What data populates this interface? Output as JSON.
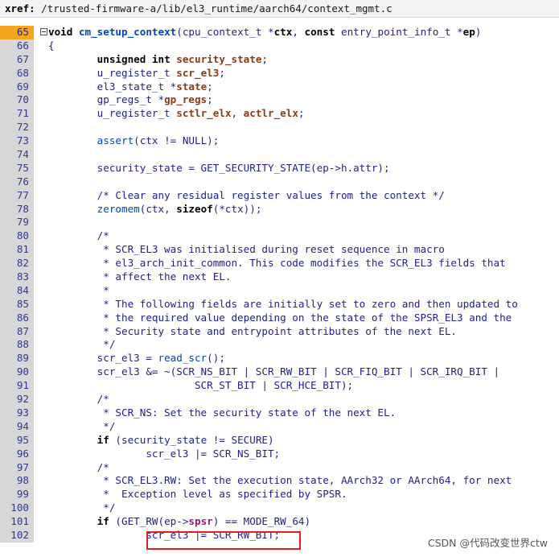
{
  "xref": {
    "label": "xref:",
    "path": "/trusted-firmware-a/lib/el3_runtime/aarch64/context_mgmt.c"
  },
  "code": {
    "lines": [
      {
        "no": "65",
        "text": "void cm_setup_context(cpu_context_t *ctx, const entry_point_info_t *ep)"
      },
      {
        "no": "66",
        "text": "{"
      },
      {
        "no": "67",
        "text": "unsigned int security_state;"
      },
      {
        "no": "68",
        "text": "u_register_t scr_el3;"
      },
      {
        "no": "69",
        "text": "el3_state_t *state;"
      },
      {
        "no": "70",
        "text": "gp_regs_t *gp_regs;"
      },
      {
        "no": "71",
        "text": "u_register_t sctlr_elx, actlr_elx;"
      },
      {
        "no": "72",
        "text": ""
      },
      {
        "no": "73",
        "text": "assert(ctx != NULL);"
      },
      {
        "no": "74",
        "text": ""
      },
      {
        "no": "75",
        "text": "security_state = GET_SECURITY_STATE(ep->h.attr);"
      },
      {
        "no": "76",
        "text": ""
      },
      {
        "no": "77",
        "text": "/* Clear any residual register values from the context */"
      },
      {
        "no": "78",
        "text": "zeromem(ctx, sizeof(*ctx));"
      },
      {
        "no": "79",
        "text": ""
      },
      {
        "no": "80",
        "text": "/*"
      },
      {
        "no": "81",
        "text": " * SCR_EL3 was initialised during reset sequence in macro"
      },
      {
        "no": "82",
        "text": " * el3_arch_init_common. This code modifies the SCR_EL3 fields that"
      },
      {
        "no": "83",
        "text": " * affect the next EL."
      },
      {
        "no": "84",
        "text": " *"
      },
      {
        "no": "85",
        "text": " * The following fields are initially set to zero and then updated to"
      },
      {
        "no": "86",
        "text": " * the required value depending on the state of the SPSR_EL3 and the"
      },
      {
        "no": "87",
        "text": " * Security state and entrypoint attributes of the next EL."
      },
      {
        "no": "88",
        "text": " */"
      },
      {
        "no": "89",
        "text": "scr_el3 = read_scr();"
      },
      {
        "no": "90",
        "text": "scr_el3 &= ~(SCR_NS_BIT | SCR_RW_BIT | SCR_FIQ_BIT | SCR_IRQ_BIT |"
      },
      {
        "no": "91",
        "text": "SCR_ST_BIT | SCR_HCE_BIT);"
      },
      {
        "no": "92",
        "text": "/*"
      },
      {
        "no": "93",
        "text": " * SCR_NS: Set the security state of the next EL."
      },
      {
        "no": "94",
        "text": " */"
      },
      {
        "no": "95",
        "text": "if (security_state != SECURE)"
      },
      {
        "no": "96",
        "text": "scr_el3 |= SCR_NS_BIT;"
      },
      {
        "no": "97",
        "text": "/*"
      },
      {
        "no": "98",
        "text": " * SCR_EL3.RW: Set the execution state, AArch32 or AArch64, for next"
      },
      {
        "no": "99",
        "text": " *  Exception level as specified by SPSR."
      },
      {
        "no": "100",
        "text": " */"
      },
      {
        "no": "101",
        "text": "if (GET_RW(ep->spsr) == MODE_RW_64)"
      },
      {
        "no": "102",
        "text": "scr_el3 |= SCR_RW_BIT;"
      }
    ]
  },
  "watermark": "CSDN @代码改变世界ctw",
  "colors": {
    "highlight_line_number": "#f4a61c",
    "gutter": "#d7d7d7",
    "annotation_box": "#e02020"
  }
}
